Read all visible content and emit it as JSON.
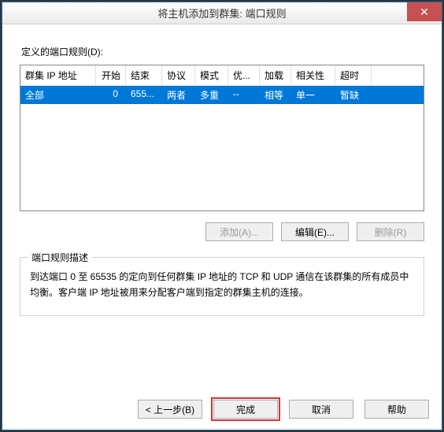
{
  "window": {
    "title": "将主机添加到群集: 端口规则",
    "close_text": "✕"
  },
  "section": {
    "define_label": "定义的端口规则(D):"
  },
  "table": {
    "headers": {
      "c0": "群集 IP 地址",
      "c1": "开始",
      "c2": "结束",
      "c3": "协议",
      "c4": "模式",
      "c5": "优...",
      "c6": "加载",
      "c7": "相关性",
      "c8": "超时"
    },
    "row": {
      "c0": "全部",
      "c1": "0",
      "c2": "655...",
      "c3": "两者",
      "c4": "多重",
      "c5": "--",
      "c6": "相等",
      "c7": "单一",
      "c8": "暂缺"
    }
  },
  "buttons": {
    "add": "添加(A)...",
    "edit": "编辑(E)...",
    "remove": "删除(R)"
  },
  "groupbox": {
    "title": "端口规则描述",
    "desc": "到达端口 0 至 65535 的定向到任何群集 IP 地址的 TCP 和 UDP 通信在该群集的所有成员中均衡。客户端 IP 地址被用来分配客户端到指定的群集主机的连接。"
  },
  "footer": {
    "back": "< 上一步(B)",
    "finish": "完成",
    "cancel": "取消",
    "help": "帮助"
  }
}
